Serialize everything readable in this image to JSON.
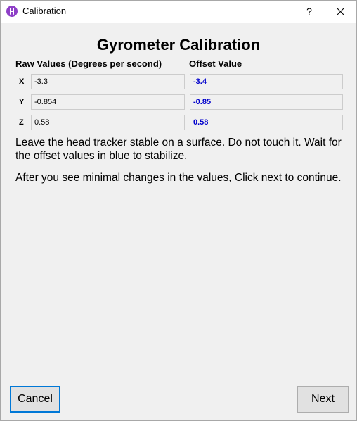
{
  "window": {
    "title": "Calibration",
    "help_label": "?"
  },
  "main": {
    "heading": "Gyrometer Calibration",
    "raw_header": "Raw Values (Degrees per second)",
    "offset_header": "Offset Value",
    "rows": [
      {
        "axis": "X",
        "raw": "-3.3",
        "offset": "-3.4"
      },
      {
        "axis": "Y",
        "raw": "-0.854",
        "offset": "-0.85"
      },
      {
        "axis": "Z",
        "raw": "0.58",
        "offset": "0.58"
      }
    ],
    "instruction_1": "Leave the head tracker stable on a surface. Do not touch it. Wait for the offset values in blue to stabilize.",
    "instruction_2": "After you see minimal changes in the values, Click next to continue."
  },
  "buttons": {
    "cancel_label": "Cancel",
    "next_label": "Next"
  },
  "colors": {
    "offset_text": "#0000cc",
    "focus_border": "#0078d7",
    "app_icon": "#8e3fc7"
  }
}
